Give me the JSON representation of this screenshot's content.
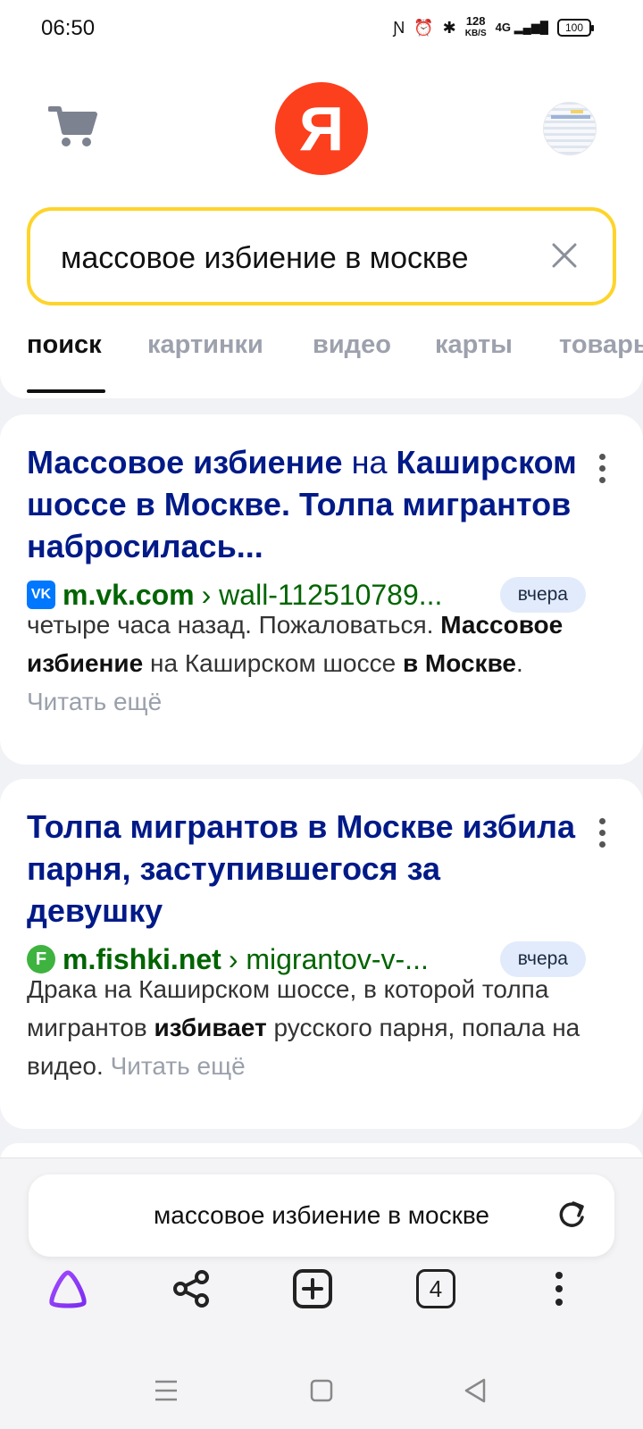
{
  "status": {
    "time": "06:50",
    "net_speed": "128",
    "net_unit": "KB/S",
    "signal": "4G",
    "battery": "100"
  },
  "header": {
    "logo": "Я"
  },
  "search": {
    "query": "массовое избиение в москве"
  },
  "tabs": [
    "поиск",
    "картинки",
    "видео",
    "карты",
    "товары"
  ],
  "results": [
    {
      "title_parts": [
        {
          "text": "Массовое избиение",
          "bold": true
        },
        {
          "text": " на ",
          "bold": false
        },
        {
          "text": "Каширском шоссе в Москве",
          "bold": true
        },
        {
          "text": ". Толпа мигрантов набросилась...",
          "bold": true
        }
      ],
      "domain": "m.vk.com",
      "path": "› wall-112510789...",
      "date": "вчера",
      "favicon": "vk-icon",
      "snippet_parts": [
        {
          "text": "четыре часа назад. Пожаловаться. ",
          "bold": false
        },
        {
          "text": "Массовое избиение",
          "bold": true
        },
        {
          "text": " на Каширском шоссе ",
          "bold": false
        },
        {
          "text": "в Москве",
          "bold": true
        },
        {
          "text": ". ",
          "bold": false
        }
      ],
      "read_more": "Читать ещё"
    },
    {
      "title_parts": [
        {
          "text": "Толпа мигрантов ",
          "bold": false
        },
        {
          "text": "в Москве избила",
          "bold": true
        },
        {
          "text": " парня, заступившегося за девушку",
          "bold": false
        }
      ],
      "domain": "m.fishki.net",
      "path": "› migrantov-v-...",
      "date": "вчера",
      "favicon": "fishki-icon",
      "favicon_letter": "F",
      "snippet_parts": [
        {
          "text": "Драка на Каширском шоссе, в которой толпа мигрантов ",
          "bold": false
        },
        {
          "text": "избивает",
          "bold": true
        },
        {
          "text": " русского парня, попала на видео. ",
          "bold": false
        }
      ],
      "read_more": "Читать ещё"
    }
  ],
  "omnibox": {
    "query": "массовое избиение в москве"
  },
  "toolbar": {
    "tabs_count": "4"
  },
  "colors": {
    "accent": "#fed42b",
    "brand": "#fc3f1d",
    "title": "#001a88",
    "url": "#006400"
  }
}
